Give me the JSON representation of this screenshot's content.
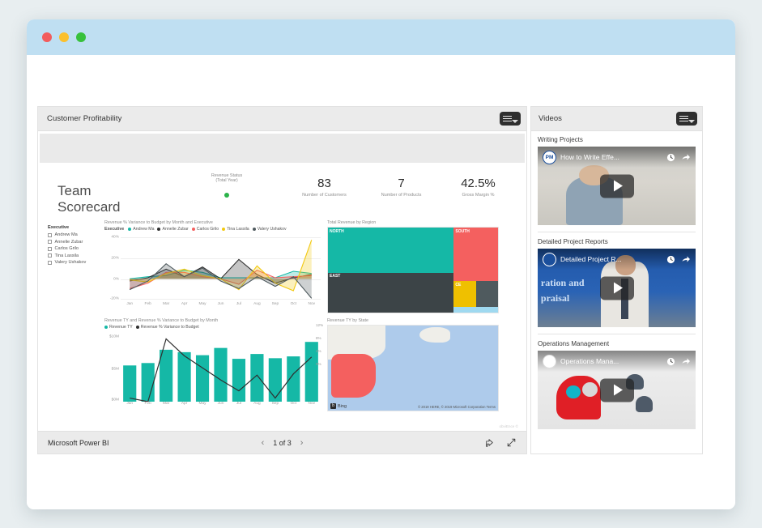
{
  "window": {
    "traffic_lights": [
      "close",
      "minimize",
      "maximize"
    ]
  },
  "powerbi": {
    "panel_title": "Customer Profitability",
    "menu_icon": "list-menu-icon",
    "footer": {
      "brand": "Microsoft Power BI",
      "prev": "‹",
      "page": "1 of 3",
      "next": "›",
      "share_icon": "share-icon",
      "fullscreen_icon": "fullscreen-icon"
    },
    "report": {
      "title": "Team Scorecard",
      "revenue_status": {
        "label": "Revenue Status (Total Year)",
        "status_color": "#2cb34a"
      },
      "kpis": [
        {
          "value": "83",
          "caption": "Number of Customers"
        },
        {
          "value": "7",
          "caption": "Number of Products"
        },
        {
          "value": "42.5%",
          "caption": "Gross Margin %"
        }
      ],
      "slicer": {
        "header": "Executive",
        "items": [
          "Andrew Ma",
          "Annelie Zubar",
          "Carlos Grilo",
          "Tina Lassila",
          "Valery Ushakov"
        ]
      },
      "watermark": "obviEnce ©"
    }
  },
  "chart_data": [
    {
      "type": "line",
      "title": "Revenue % Variance to Budget by Month and Executive",
      "legend_label": "Executive",
      "legend_position": "top",
      "xlabel": "",
      "ylabel": "",
      "categories": [
        "Jan",
        "Feb",
        "Mar",
        "Apr",
        "May",
        "Jun",
        "Jul",
        "Aug",
        "Sep",
        "Oct",
        "Nov"
      ],
      "ytick_labels": [
        "40%",
        "20%",
        "0%",
        "-20%"
      ],
      "ylim": [
        -20,
        40
      ],
      "grid": true,
      "series": [
        {
          "name": "Andrew Ma",
          "color": "#15b8a6",
          "values": [
            0,
            2,
            3,
            8,
            6,
            1,
            1,
            1,
            1,
            7,
            5
          ]
        },
        {
          "name": "Annelie Zubar",
          "color": "#2f2f2f",
          "values": [
            -2,
            1,
            9,
            2,
            11,
            0,
            18,
            4,
            -4,
            1,
            4
          ]
        },
        {
          "name": "Carlos Grilo",
          "color": "#f4605f",
          "values": [
            -9,
            -4,
            6,
            6,
            2,
            0,
            -5,
            8,
            1,
            2,
            3
          ]
        },
        {
          "name": "Tina Lassila",
          "color": "#f2c80f",
          "values": [
            -1,
            -3,
            5,
            9,
            3,
            0,
            -10,
            12,
            -4,
            -11,
            36
          ]
        },
        {
          "name": "Valery Ushakov",
          "color": "#4f5a5e",
          "values": [
            -10,
            -2,
            14,
            2,
            10,
            -2,
            -9,
            2,
            -7,
            2,
            -18
          ]
        }
      ]
    },
    {
      "type": "bar",
      "title": "Revenue TY and Revenue % Variance to Budget by Month",
      "legend_position": "top",
      "categories": [
        "Jan",
        "Feb",
        "Mar",
        "Apr",
        "May",
        "Jun",
        "Jul",
        "Aug",
        "Sep",
        "Oct",
        "Nov"
      ],
      "ytick_labels": [
        "$10M",
        "$5M",
        "$0M"
      ],
      "ylim": [
        0,
        11
      ],
      "series": [
        {
          "name": "Revenue TY",
          "color": "#15b8a6",
          "type": "bar",
          "values": [
            6.0,
            6.4,
            8.6,
            8.2,
            7.7,
            8.9,
            7.1,
            7.9,
            7.2,
            7.5,
            9.9
          ]
        },
        {
          "name": "Revenue % Variance to Budget",
          "color": "#2f2f2f",
          "type": "line",
          "values": [
            0.6,
            0.0,
            10.4,
            7.6,
            5.6,
            3.6,
            1.8,
            4.4,
            0.6,
            4.6,
            7.4
          ]
        }
      ]
    },
    {
      "type": "treemap",
      "title": "Total Revenue by Region",
      "items": [
        {
          "label": "NORTH",
          "color": "#15b8a6",
          "value": 46
        },
        {
          "label": "EAST",
          "color": "#3c4447",
          "value": 33
        },
        {
          "label": "SOUTH",
          "color": "#f4605f",
          "value": 14
        },
        {
          "label": "CE",
          "color": "#efc000",
          "value": 3
        },
        {
          "label": "",
          "color": "#4f5a5e",
          "value": 2
        },
        {
          "label": "",
          "color": "#9fd9f0",
          "value": 1
        }
      ]
    },
    {
      "type": "map",
      "title": "Revenue TY by State",
      "ytick_labels": [
        "12%",
        "8%",
        "4%",
        "0%"
      ],
      "provider": "Bing",
      "attribution": "© 2019 HERE, © 2019 Microsoft Corporation  Terms",
      "highlight_color": "#f4605f"
    }
  ],
  "videos": {
    "panel_title": "Videos",
    "menu_icon": "list-menu-icon",
    "items": [
      {
        "heading": "Writing Projects",
        "overlay_title": "How to Write Effe...",
        "channel_badge": "PM",
        "play_icon": "play-icon",
        "watch_later_icon": "clock-icon",
        "share_icon": "share-icon"
      },
      {
        "heading": "Detailed Project Reports",
        "overlay_title": "Detailed Project R...",
        "channel_badge": "",
        "play_icon": "play-icon",
        "watch_later_icon": "clock-icon",
        "share_icon": "share-icon"
      },
      {
        "heading": "Operations Management",
        "overlay_title": "Operations Mana...",
        "channel_badge": "",
        "play_icon": "play-icon",
        "watch_later_icon": "clock-icon",
        "share_icon": "share-icon"
      }
    ]
  }
}
